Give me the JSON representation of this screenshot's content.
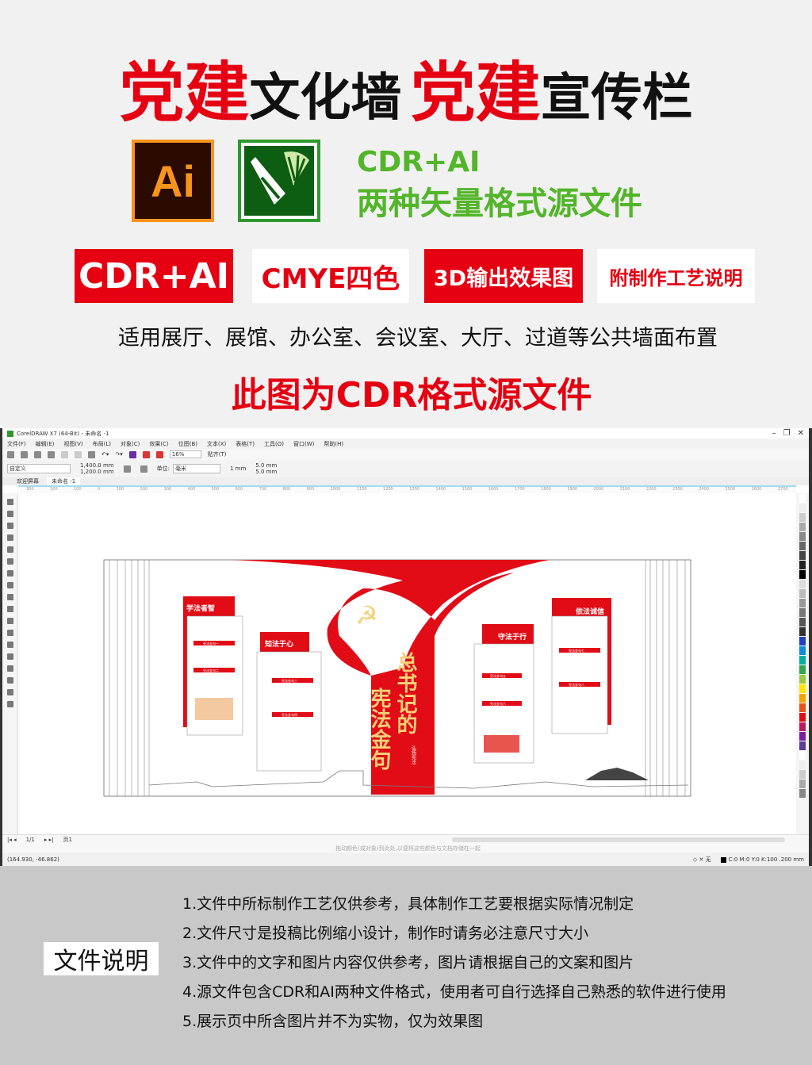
{
  "hero": {
    "t1": "党建",
    "t2": "文化墙",
    "t3": "党建",
    "t4": "宣传栏"
  },
  "logos": {
    "ai": "Ai",
    "cdr_icon": "coreldraw-icon"
  },
  "formats": {
    "line1": "CDR+AI",
    "line2": "两种矢量格式源文件"
  },
  "badges": [
    "CDR+AI",
    "CMYE四色",
    "3D输出效果图",
    "附制作工艺说明"
  ],
  "usage": "适用展厅、展馆、办公室、会议室、大厅、过道等公共墙面布置",
  "notice": "此图为CDR格式源文件",
  "app": {
    "title": "CorelDRAW X7 (64-Bit) - 未命名 -1",
    "menu": [
      "文件(F)",
      "编辑(E)",
      "视图(V)",
      "布局(L)",
      "对象(C)",
      "效果(C)",
      "位图(B)",
      "文本(X)",
      "表格(T)",
      "工具(O)",
      "窗口(W)",
      "帮助(H)"
    ],
    "zoom": "16%",
    "snap": "贴齐(T)",
    "preset": "自定义",
    "width": "1,400.0 mm",
    "height": "1,200.0 mm",
    "unit_label": "单位:",
    "unit": "毫米",
    "nudge": "1 mm",
    "dup_x": "5.0 mm",
    "dup_y": "5.0 mm",
    "tabs": [
      "欢迎屏幕",
      "未命名 -1"
    ],
    "ruler": [
      "300",
      "200",
      "100",
      "0",
      "100",
      "200",
      "300",
      "400",
      "500",
      "600",
      "700",
      "800",
      "900",
      "1000",
      "1100",
      "1200",
      "1300",
      "1400",
      "1500",
      "1600",
      "1700",
      "1800",
      "1900",
      "2000",
      "2100",
      "2200",
      "2300",
      "2400",
      "2500",
      "2600",
      "2700"
    ],
    "page_nav": "1/1",
    "page_tab": "页1",
    "hint": "拖动颜色(或对象)到此处,以便将这些颜色与文档存储在一起",
    "coords": "(164.930, -46.862)",
    "fill_none": "无",
    "outline": "C:0 M:0 Y:0 K:100  .200 mm"
  },
  "design": {
    "panels": [
      "学法者智",
      "知法于心",
      "守法于行",
      "依法诚信"
    ],
    "items": [
      "宪法金句一",
      "宪法金句二",
      "宪法金句三",
      "宪法金句四",
      "宪法金句五",
      "宪法金句六",
      "宪法金句七",
      "宪法金句八"
    ],
    "banner_a": "总书记的",
    "banner_b": "宪法金句",
    "banner_sub": "弘扬宪法"
  },
  "docs": {
    "label": "文件说明",
    "notes": [
      "1.文件中所标制作工艺仅供参考，具体制作工艺要根据实际情况制定",
      "2.文件尺寸是投稿比例缩小设计，制作时请务必注意尺寸大小",
      "3.文件中的文字和图片内容仅供参考，图片请根据自己的文案和图片",
      "4.源文件包含CDR和AI两种文件格式，使用者可自行选择自己熟悉的软件进行使用",
      "5.展示页中所含图片并不为实物，仅为效果图"
    ]
  },
  "colors": {
    "red": "#e50012",
    "green": "#53b52a",
    "ai_orange": "#f7941d",
    "gray": "#c8c8c8"
  }
}
